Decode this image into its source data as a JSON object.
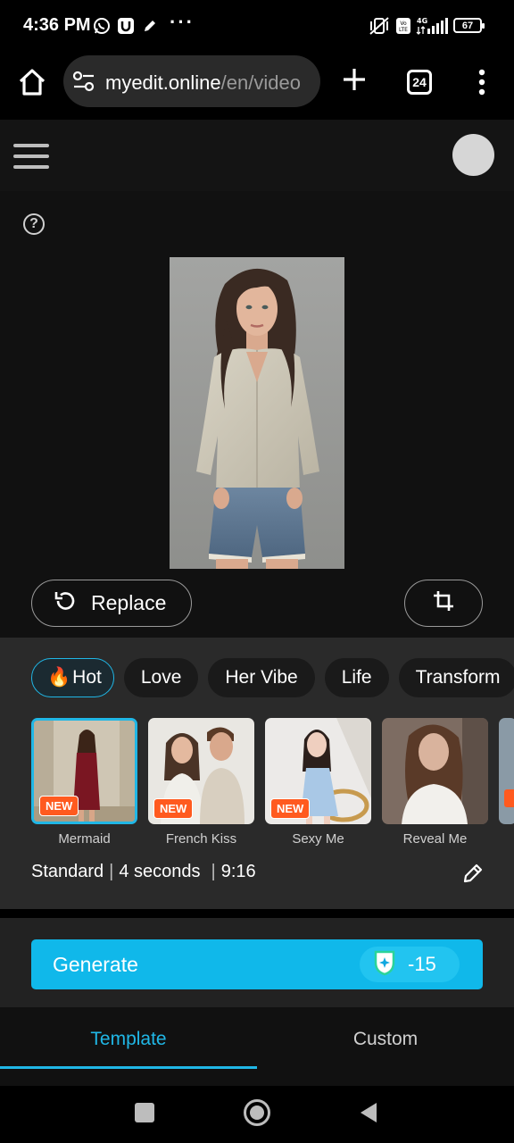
{
  "status_bar": {
    "time": "4:36 PM",
    "battery": "67",
    "network": "4G"
  },
  "browser": {
    "url_host": "myedit.online",
    "url_path": "/en/video",
    "tab_count": "24"
  },
  "editor": {
    "replace_label": "Replace"
  },
  "categories": [
    {
      "label": "Hot",
      "icon": "flame-icon",
      "active": true
    },
    {
      "label": "Love",
      "active": false
    },
    {
      "label": "Her Vibe",
      "active": false
    },
    {
      "label": "Life",
      "active": false
    },
    {
      "label": "Transform",
      "active": false
    }
  ],
  "templates": [
    {
      "name": "Mermaid",
      "badge": "NEW",
      "selected": true
    },
    {
      "name": "French Kiss",
      "badge": "NEW",
      "selected": false
    },
    {
      "name": "Sexy Me",
      "badge": "NEW",
      "selected": false
    },
    {
      "name": "Reveal Me",
      "badge": "",
      "selected": false
    }
  ],
  "settings": {
    "quality": "Standard",
    "duration": "4 seconds",
    "ratio": "9:16",
    "separator": "|"
  },
  "generate": {
    "label": "Generate",
    "cost": "-15"
  },
  "tabs": {
    "template": "Template",
    "custom": "Custom"
  },
  "colors": {
    "accent": "#10b8ea",
    "badge": "#ff5a1f"
  }
}
